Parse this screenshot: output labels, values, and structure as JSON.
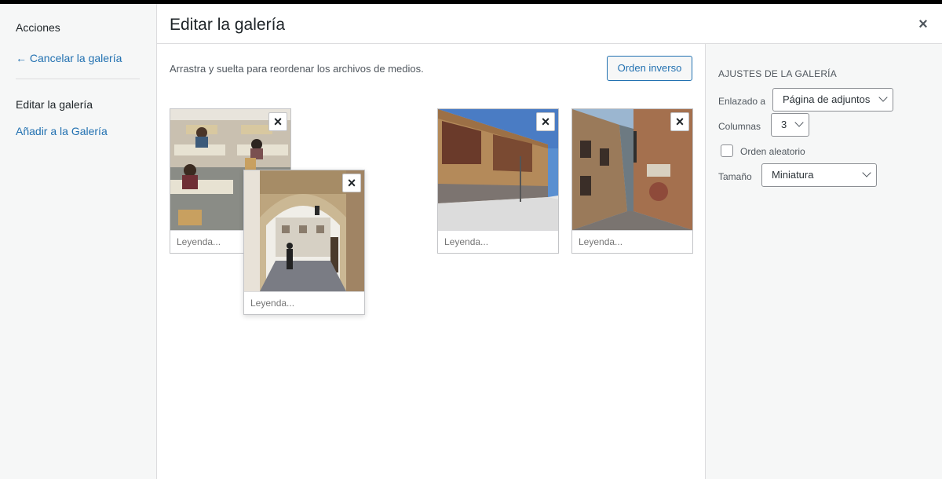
{
  "menu": {
    "heading": "Acciones",
    "cancel": "← Cancelar la galería",
    "edit_gallery": "Editar la galería",
    "add_to_gallery": "Añadir a la Galería"
  },
  "frame": {
    "title": "Editar la galería",
    "close": "×"
  },
  "content": {
    "instructions": "Arrastra y suelta para reordenar los archivos de medios.",
    "reverse_order": "Orden inverso"
  },
  "attachments": [
    {
      "caption_placeholder": "Leyenda...",
      "remove": "×"
    },
    {
      "caption_placeholder": "Leyenda...",
      "remove": "×"
    },
    {
      "caption_placeholder": "Leyenda...",
      "remove": "×"
    },
    {
      "caption_placeholder": "Leyenda...",
      "remove": "×"
    }
  ],
  "settings": {
    "title": "AJUSTES DE LA GALERÍA",
    "link_label": "Enlazado a",
    "link_value": "Página de adjuntos",
    "columns_label": "Columnas",
    "columns_value": "3",
    "random_label": "Orden aleatorio",
    "size_label": "Tamaño",
    "size_value": "Miniatura"
  }
}
